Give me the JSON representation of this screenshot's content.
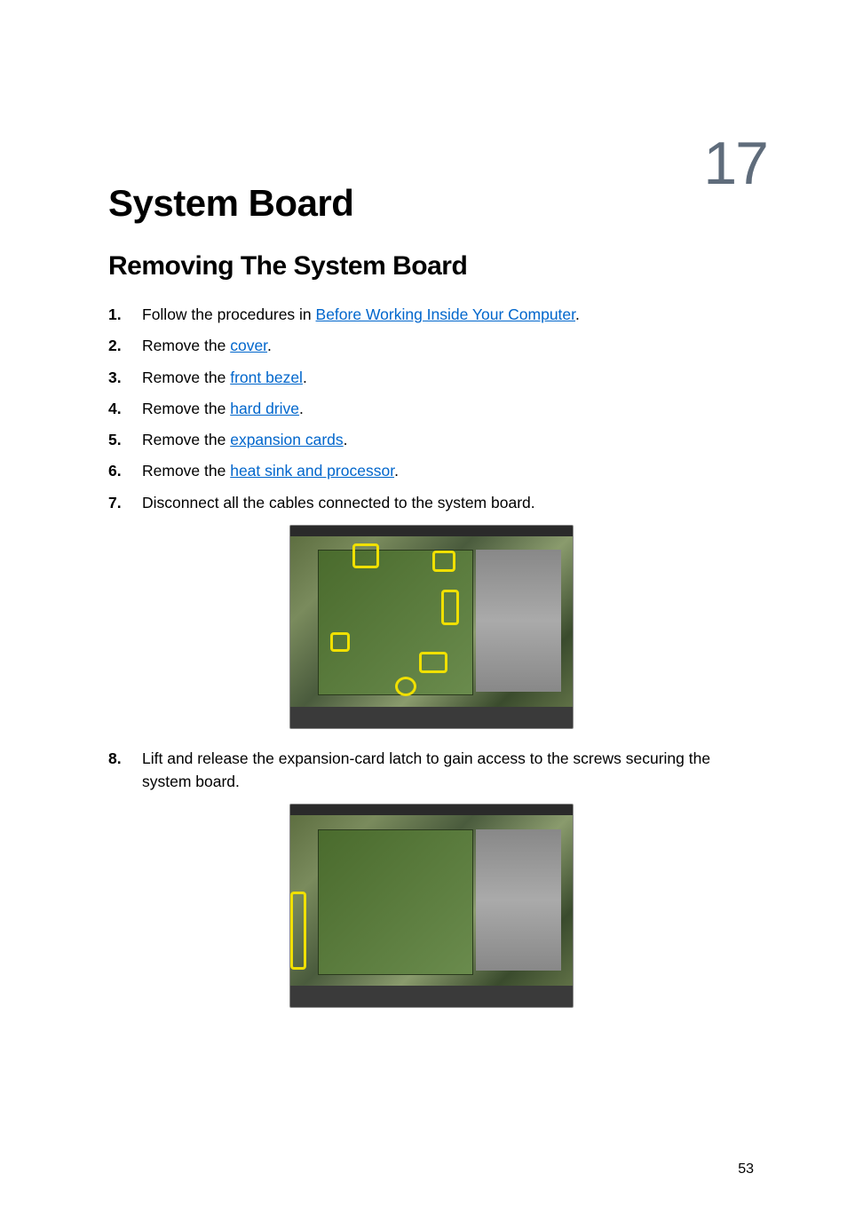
{
  "chapter": {
    "number": "17",
    "title": "System Board"
  },
  "section": {
    "title": "Removing The System Board"
  },
  "steps": [
    {
      "num": "1.",
      "prefix": "Follow the procedures in ",
      "link": "Before Working Inside Your Computer",
      "suffix": "."
    },
    {
      "num": "2.",
      "prefix": "Remove the ",
      "link": "cover",
      "suffix": "."
    },
    {
      "num": "3.",
      "prefix": "Remove the ",
      "link": "front bezel",
      "suffix": "."
    },
    {
      "num": "4.",
      "prefix": "Remove the ",
      "link": "hard drive",
      "suffix": "."
    },
    {
      "num": "5.",
      "prefix": "Remove the ",
      "link": "expansion cards",
      "suffix": "."
    },
    {
      "num": "6.",
      "prefix": "Remove the ",
      "link": "heat sink and processor",
      "suffix": "."
    },
    {
      "num": "7.",
      "prefix": "Disconnect all the cables connected to the system board.",
      "link": "",
      "suffix": ""
    },
    {
      "num": "8.",
      "prefix": "Lift and release the expansion-card latch to gain access to the screws securing the system board.",
      "link": "",
      "suffix": ""
    }
  ],
  "page_number": "53"
}
